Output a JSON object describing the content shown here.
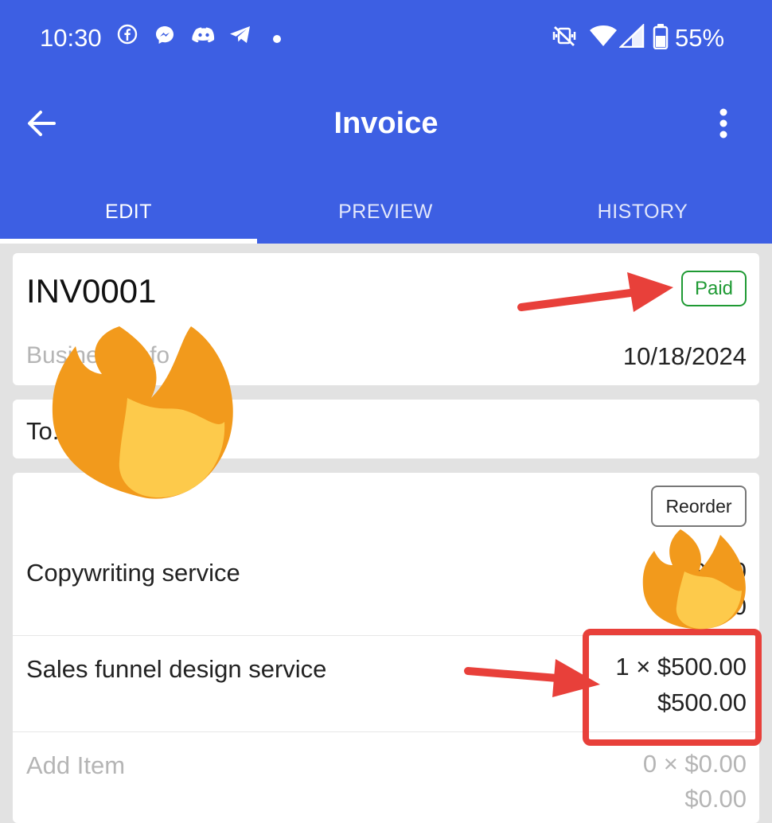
{
  "status_bar": {
    "time": "10:30",
    "battery": "55%",
    "notification_icons": [
      "facebook-icon",
      "messenger-icon",
      "discord-icon",
      "telegram-icon",
      "dot-icon"
    ],
    "system_icons": [
      "vibrate-off-icon",
      "wifi-icon",
      "signal-icon",
      "battery-icon"
    ]
  },
  "toolbar": {
    "title": "Invoice",
    "back_icon": "arrow-left-icon",
    "more_icon": "more-vertical-icon"
  },
  "tabs": [
    {
      "label": "EDIT",
      "active": true
    },
    {
      "label": "PREVIEW",
      "active": false
    },
    {
      "label": "HISTORY",
      "active": false
    }
  ],
  "invoice": {
    "number": "INV0001",
    "status": "Paid",
    "business_info": "Business Info",
    "date": "10/18/2024",
    "to": "To: Or                  o"
  },
  "items_section": {
    "reorder_label": "Reorder",
    "items": [
      {
        "name": "Copywriting service",
        "qty_price": "1 × $    .00",
        "total": "0"
      },
      {
        "name": "Sales funnel design service",
        "qty_price": "1 × $500.00",
        "total": "$500.00"
      }
    ],
    "add_item": {
      "name": "Add Item",
      "qty_price": "0 × $0.00",
      "total": "$0.00"
    }
  },
  "colors": {
    "app_bar": "#3d5fe3",
    "paid_green": "#1f9a34",
    "annotation_red": "#e8403a",
    "fire_orange": "#f29a1c",
    "fire_yellow": "#fdca4b"
  }
}
